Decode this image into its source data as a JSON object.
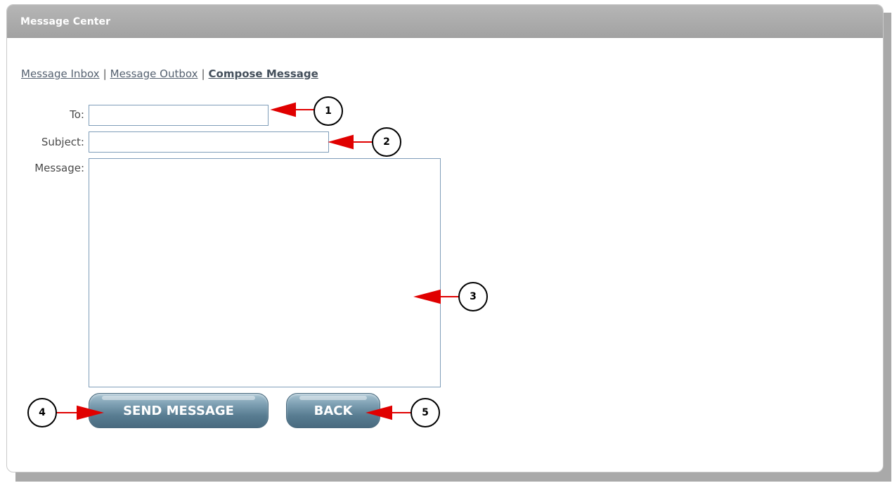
{
  "panel": {
    "title": "Message Center"
  },
  "nav": {
    "inbox_label": "Message Inbox",
    "outbox_label": "Message Outbox",
    "compose_label": "Compose Message",
    "separator": "|"
  },
  "form": {
    "to_label": "To:",
    "to_value": "",
    "subject_label": "Subject:",
    "subject_value": "",
    "message_label": "Message:",
    "message_value": ""
  },
  "buttons": {
    "send_label": "SEND MESSAGE",
    "back_label": "BACK"
  },
  "callouts": {
    "c1": "1",
    "c2": "2",
    "c3": "3",
    "c4": "4",
    "c5": "5"
  },
  "colors": {
    "header_bg": "#a8a8a8",
    "arrow_red": "#e00000",
    "button_teal": "#5f8399",
    "field_border": "#7f9db9"
  }
}
